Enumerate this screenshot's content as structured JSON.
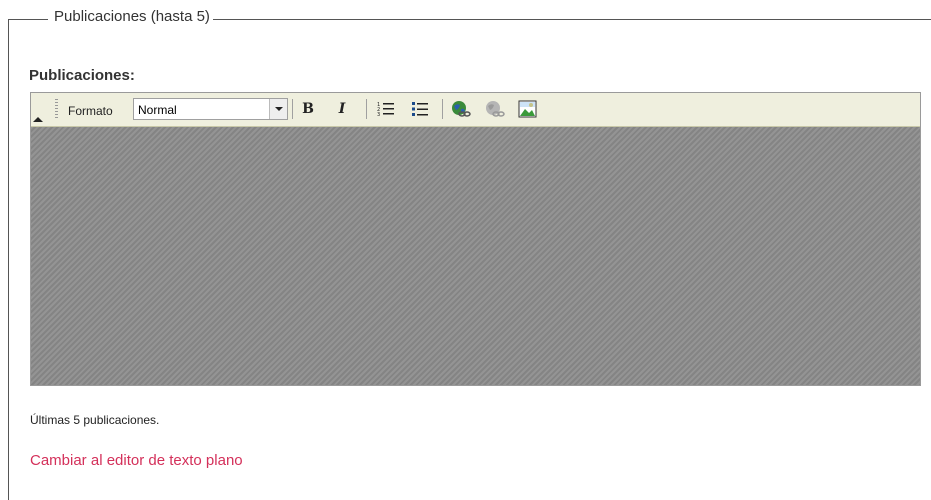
{
  "fieldset": {
    "legend": "Publicaciones (hasta 5)"
  },
  "field": {
    "label": "Publicaciones:"
  },
  "toolbar": {
    "format_label": "Formato",
    "format_value": "Normal",
    "buttons": [
      {
        "name": "bold-button",
        "icon": "bold-icon"
      },
      {
        "name": "italic-button",
        "icon": "italic-icon"
      },
      {
        "name": "ordered-list-button",
        "icon": "ordered-list-icon"
      },
      {
        "name": "unordered-list-button",
        "icon": "unordered-list-icon"
      },
      {
        "name": "insert-link-button",
        "icon": "globe-link-icon"
      },
      {
        "name": "remove-link-button",
        "icon": "globe-unlink-icon"
      },
      {
        "name": "insert-image-button",
        "icon": "image-icon"
      }
    ]
  },
  "colors": {
    "toolbar_bg": "#efefde",
    "editor_bg": "#8c8c8c",
    "link": "#d4305a"
  },
  "help_text": "Últimas 5 publicaciones.",
  "switch_link": "Cambiar al editor de texto plano"
}
